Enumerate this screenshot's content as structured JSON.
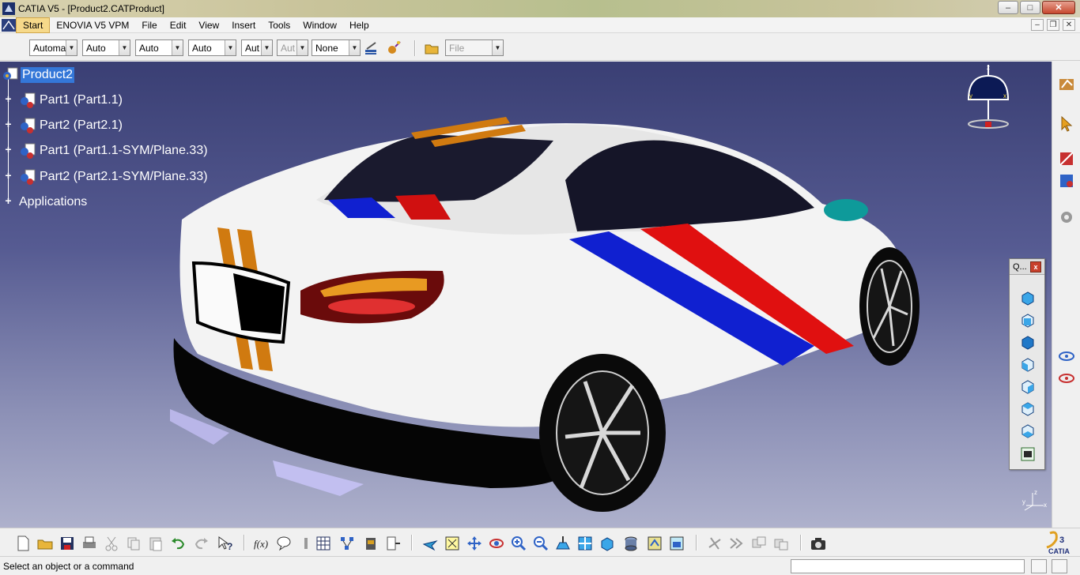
{
  "window": {
    "title": "CATIA V5 - [Product2.CATProduct]",
    "minimize": "–",
    "maximize": "□",
    "close": "✕"
  },
  "menubar": {
    "items": [
      "Start",
      "ENOVIA V5 VPM",
      "File",
      "Edit",
      "View",
      "Insert",
      "Tools",
      "Window",
      "Help"
    ],
    "mdi": [
      "–",
      "❐",
      "✕"
    ]
  },
  "toolbar_top": {
    "dropdowns": [
      "Automa",
      "Auto",
      "Auto",
      "Auto",
      "Aut",
      "Aut",
      "None"
    ],
    "file_dropdown": "File"
  },
  "tree": {
    "root": "Product2",
    "children": [
      "Part1 (Part1.1)",
      "Part2 (Part2.1)",
      "Part1 (Part1.1-SYM/Plane.33)",
      "Part2 (Part2.1-SYM/Plane.33)"
    ],
    "applications": "Applications"
  },
  "compass": {
    "z": "z",
    "x": "x",
    "y": "y"
  },
  "axes": {
    "labels": [
      "y",
      "z",
      "x"
    ]
  },
  "floating_toolbar": {
    "title": "Q...",
    "close": "x"
  },
  "status": {
    "message": "Select an object or a command"
  },
  "brand": {
    "logo_text": "CATIA"
  },
  "colors": {
    "viewport_top": "#3a3f74",
    "viewport_bottom": "#aeb1cc",
    "selection": "#3477d8",
    "car_body": "#ffffff",
    "stripe_red": "#e01010",
    "stripe_blue": "#1020d0",
    "stripe_orange": "#d07a10"
  }
}
